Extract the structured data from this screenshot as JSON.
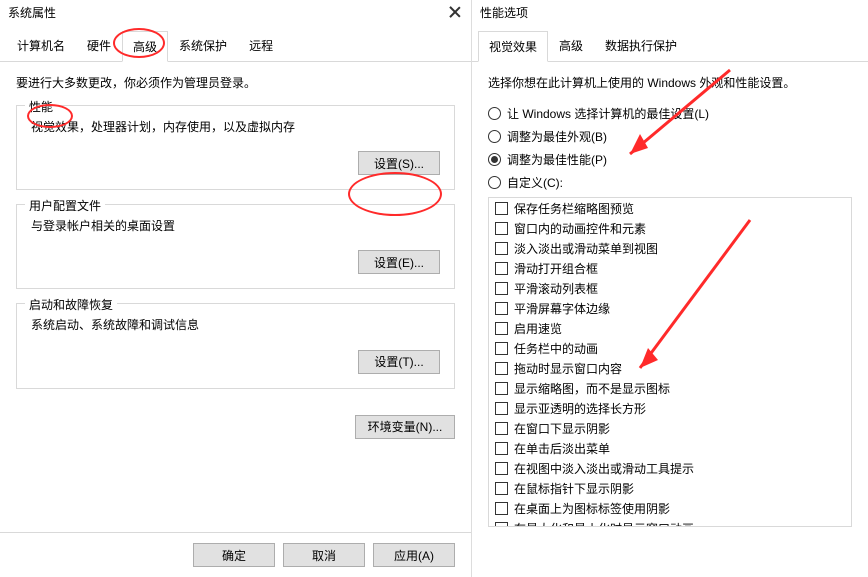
{
  "left": {
    "title": "系统属性",
    "tabs": [
      "计算机名",
      "硬件",
      "高级",
      "系统保护",
      "远程"
    ],
    "activeTab": 2,
    "intro": "要进行大多数更改，你必须作为管理员登录。",
    "fieldsets": [
      {
        "legend": "性能",
        "desc": "视觉效果，处理器计划，内存使用，以及虚拟内存",
        "btn": "设置(S)..."
      },
      {
        "legend": "用户配置文件",
        "desc": "与登录帐户相关的桌面设置",
        "btn": "设置(E)..."
      },
      {
        "legend": "启动和故障恢复",
        "desc": "系统启动、系统故障和调试信息",
        "btn": "设置(T)..."
      }
    ],
    "envBtn": "环境变量(N)...",
    "footer": [
      "确定",
      "取消",
      "应用(A)"
    ]
  },
  "right": {
    "title": "性能选项",
    "tabs": [
      "视觉效果",
      "高级",
      "数据执行保护"
    ],
    "activeTab": 0,
    "intro": "选择你想在此计算机上使用的 Windows 外观和性能设置。",
    "radios": [
      "让 Windows 选择计算机的最佳设置(L)",
      "调整为最佳外观(B)",
      "调整为最佳性能(P)",
      "自定义(C):"
    ],
    "radioSelected": 2,
    "checkboxes": [
      "保存任务栏缩略图预览",
      "窗口内的动画控件和元素",
      "淡入淡出或滑动菜单到视图",
      "滑动打开组合框",
      "平滑滚动列表框",
      "平滑屏幕字体边缘",
      "启用速览",
      "任务栏中的动画",
      "拖动时显示窗口内容",
      "显示缩略图，而不是显示图标",
      "显示亚透明的选择长方形",
      "在窗口下显示阴影",
      "在单击后淡出菜单",
      "在视图中淡入淡出或滑动工具提示",
      "在鼠标指针下显示阴影",
      "在桌面上为图标标签使用阴影",
      "在最大化和最小化时显示窗口动画"
    ]
  }
}
